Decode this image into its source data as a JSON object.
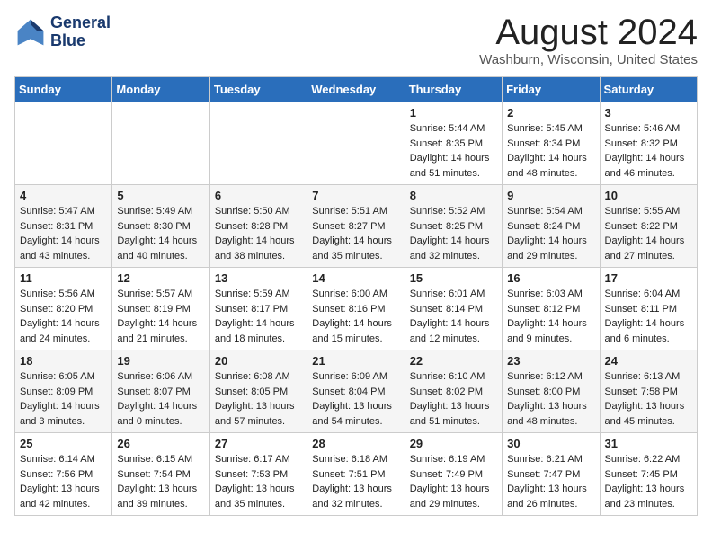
{
  "header": {
    "logo_line1": "General",
    "logo_line2": "Blue",
    "month_year": "August 2024",
    "location": "Washburn, Wisconsin, United States"
  },
  "weekdays": [
    "Sunday",
    "Monday",
    "Tuesday",
    "Wednesday",
    "Thursday",
    "Friday",
    "Saturday"
  ],
  "weeks": [
    [
      {
        "day": "",
        "sunrise": "",
        "sunset": "",
        "daylight": ""
      },
      {
        "day": "",
        "sunrise": "",
        "sunset": "",
        "daylight": ""
      },
      {
        "day": "",
        "sunrise": "",
        "sunset": "",
        "daylight": ""
      },
      {
        "day": "",
        "sunrise": "",
        "sunset": "",
        "daylight": ""
      },
      {
        "day": "1",
        "sunrise": "Sunrise: 5:44 AM",
        "sunset": "Sunset: 8:35 PM",
        "daylight": "Daylight: 14 hours and 51 minutes."
      },
      {
        "day": "2",
        "sunrise": "Sunrise: 5:45 AM",
        "sunset": "Sunset: 8:34 PM",
        "daylight": "Daylight: 14 hours and 48 minutes."
      },
      {
        "day": "3",
        "sunrise": "Sunrise: 5:46 AM",
        "sunset": "Sunset: 8:32 PM",
        "daylight": "Daylight: 14 hours and 46 minutes."
      }
    ],
    [
      {
        "day": "4",
        "sunrise": "Sunrise: 5:47 AM",
        "sunset": "Sunset: 8:31 PM",
        "daylight": "Daylight: 14 hours and 43 minutes."
      },
      {
        "day": "5",
        "sunrise": "Sunrise: 5:49 AM",
        "sunset": "Sunset: 8:30 PM",
        "daylight": "Daylight: 14 hours and 40 minutes."
      },
      {
        "day": "6",
        "sunrise": "Sunrise: 5:50 AM",
        "sunset": "Sunset: 8:28 PM",
        "daylight": "Daylight: 14 hours and 38 minutes."
      },
      {
        "day": "7",
        "sunrise": "Sunrise: 5:51 AM",
        "sunset": "Sunset: 8:27 PM",
        "daylight": "Daylight: 14 hours and 35 minutes."
      },
      {
        "day": "8",
        "sunrise": "Sunrise: 5:52 AM",
        "sunset": "Sunset: 8:25 PM",
        "daylight": "Daylight: 14 hours and 32 minutes."
      },
      {
        "day": "9",
        "sunrise": "Sunrise: 5:54 AM",
        "sunset": "Sunset: 8:24 PM",
        "daylight": "Daylight: 14 hours and 29 minutes."
      },
      {
        "day": "10",
        "sunrise": "Sunrise: 5:55 AM",
        "sunset": "Sunset: 8:22 PM",
        "daylight": "Daylight: 14 hours and 27 minutes."
      }
    ],
    [
      {
        "day": "11",
        "sunrise": "Sunrise: 5:56 AM",
        "sunset": "Sunset: 8:20 PM",
        "daylight": "Daylight: 14 hours and 24 minutes."
      },
      {
        "day": "12",
        "sunrise": "Sunrise: 5:57 AM",
        "sunset": "Sunset: 8:19 PM",
        "daylight": "Daylight: 14 hours and 21 minutes."
      },
      {
        "day": "13",
        "sunrise": "Sunrise: 5:59 AM",
        "sunset": "Sunset: 8:17 PM",
        "daylight": "Daylight: 14 hours and 18 minutes."
      },
      {
        "day": "14",
        "sunrise": "Sunrise: 6:00 AM",
        "sunset": "Sunset: 8:16 PM",
        "daylight": "Daylight: 14 hours and 15 minutes."
      },
      {
        "day": "15",
        "sunrise": "Sunrise: 6:01 AM",
        "sunset": "Sunset: 8:14 PM",
        "daylight": "Daylight: 14 hours and 12 minutes."
      },
      {
        "day": "16",
        "sunrise": "Sunrise: 6:03 AM",
        "sunset": "Sunset: 8:12 PM",
        "daylight": "Daylight: 14 hours and 9 minutes."
      },
      {
        "day": "17",
        "sunrise": "Sunrise: 6:04 AM",
        "sunset": "Sunset: 8:11 PM",
        "daylight": "Daylight: 14 hours and 6 minutes."
      }
    ],
    [
      {
        "day": "18",
        "sunrise": "Sunrise: 6:05 AM",
        "sunset": "Sunset: 8:09 PM",
        "daylight": "Daylight: 14 hours and 3 minutes."
      },
      {
        "day": "19",
        "sunrise": "Sunrise: 6:06 AM",
        "sunset": "Sunset: 8:07 PM",
        "daylight": "Daylight: 14 hours and 0 minutes."
      },
      {
        "day": "20",
        "sunrise": "Sunrise: 6:08 AM",
        "sunset": "Sunset: 8:05 PM",
        "daylight": "Daylight: 13 hours and 57 minutes."
      },
      {
        "day": "21",
        "sunrise": "Sunrise: 6:09 AM",
        "sunset": "Sunset: 8:04 PM",
        "daylight": "Daylight: 13 hours and 54 minutes."
      },
      {
        "day": "22",
        "sunrise": "Sunrise: 6:10 AM",
        "sunset": "Sunset: 8:02 PM",
        "daylight": "Daylight: 13 hours and 51 minutes."
      },
      {
        "day": "23",
        "sunrise": "Sunrise: 6:12 AM",
        "sunset": "Sunset: 8:00 PM",
        "daylight": "Daylight: 13 hours and 48 minutes."
      },
      {
        "day": "24",
        "sunrise": "Sunrise: 6:13 AM",
        "sunset": "Sunset: 7:58 PM",
        "daylight": "Daylight: 13 hours and 45 minutes."
      }
    ],
    [
      {
        "day": "25",
        "sunrise": "Sunrise: 6:14 AM",
        "sunset": "Sunset: 7:56 PM",
        "daylight": "Daylight: 13 hours and 42 minutes."
      },
      {
        "day": "26",
        "sunrise": "Sunrise: 6:15 AM",
        "sunset": "Sunset: 7:54 PM",
        "daylight": "Daylight: 13 hours and 39 minutes."
      },
      {
        "day": "27",
        "sunrise": "Sunrise: 6:17 AM",
        "sunset": "Sunset: 7:53 PM",
        "daylight": "Daylight: 13 hours and 35 minutes."
      },
      {
        "day": "28",
        "sunrise": "Sunrise: 6:18 AM",
        "sunset": "Sunset: 7:51 PM",
        "daylight": "Daylight: 13 hours and 32 minutes."
      },
      {
        "day": "29",
        "sunrise": "Sunrise: 6:19 AM",
        "sunset": "Sunset: 7:49 PM",
        "daylight": "Daylight: 13 hours and 29 minutes."
      },
      {
        "day": "30",
        "sunrise": "Sunrise: 6:21 AM",
        "sunset": "Sunset: 7:47 PM",
        "daylight": "Daylight: 13 hours and 26 minutes."
      },
      {
        "day": "31",
        "sunrise": "Sunrise: 6:22 AM",
        "sunset": "Sunset: 7:45 PM",
        "daylight": "Daylight: 13 hours and 23 minutes."
      }
    ]
  ]
}
